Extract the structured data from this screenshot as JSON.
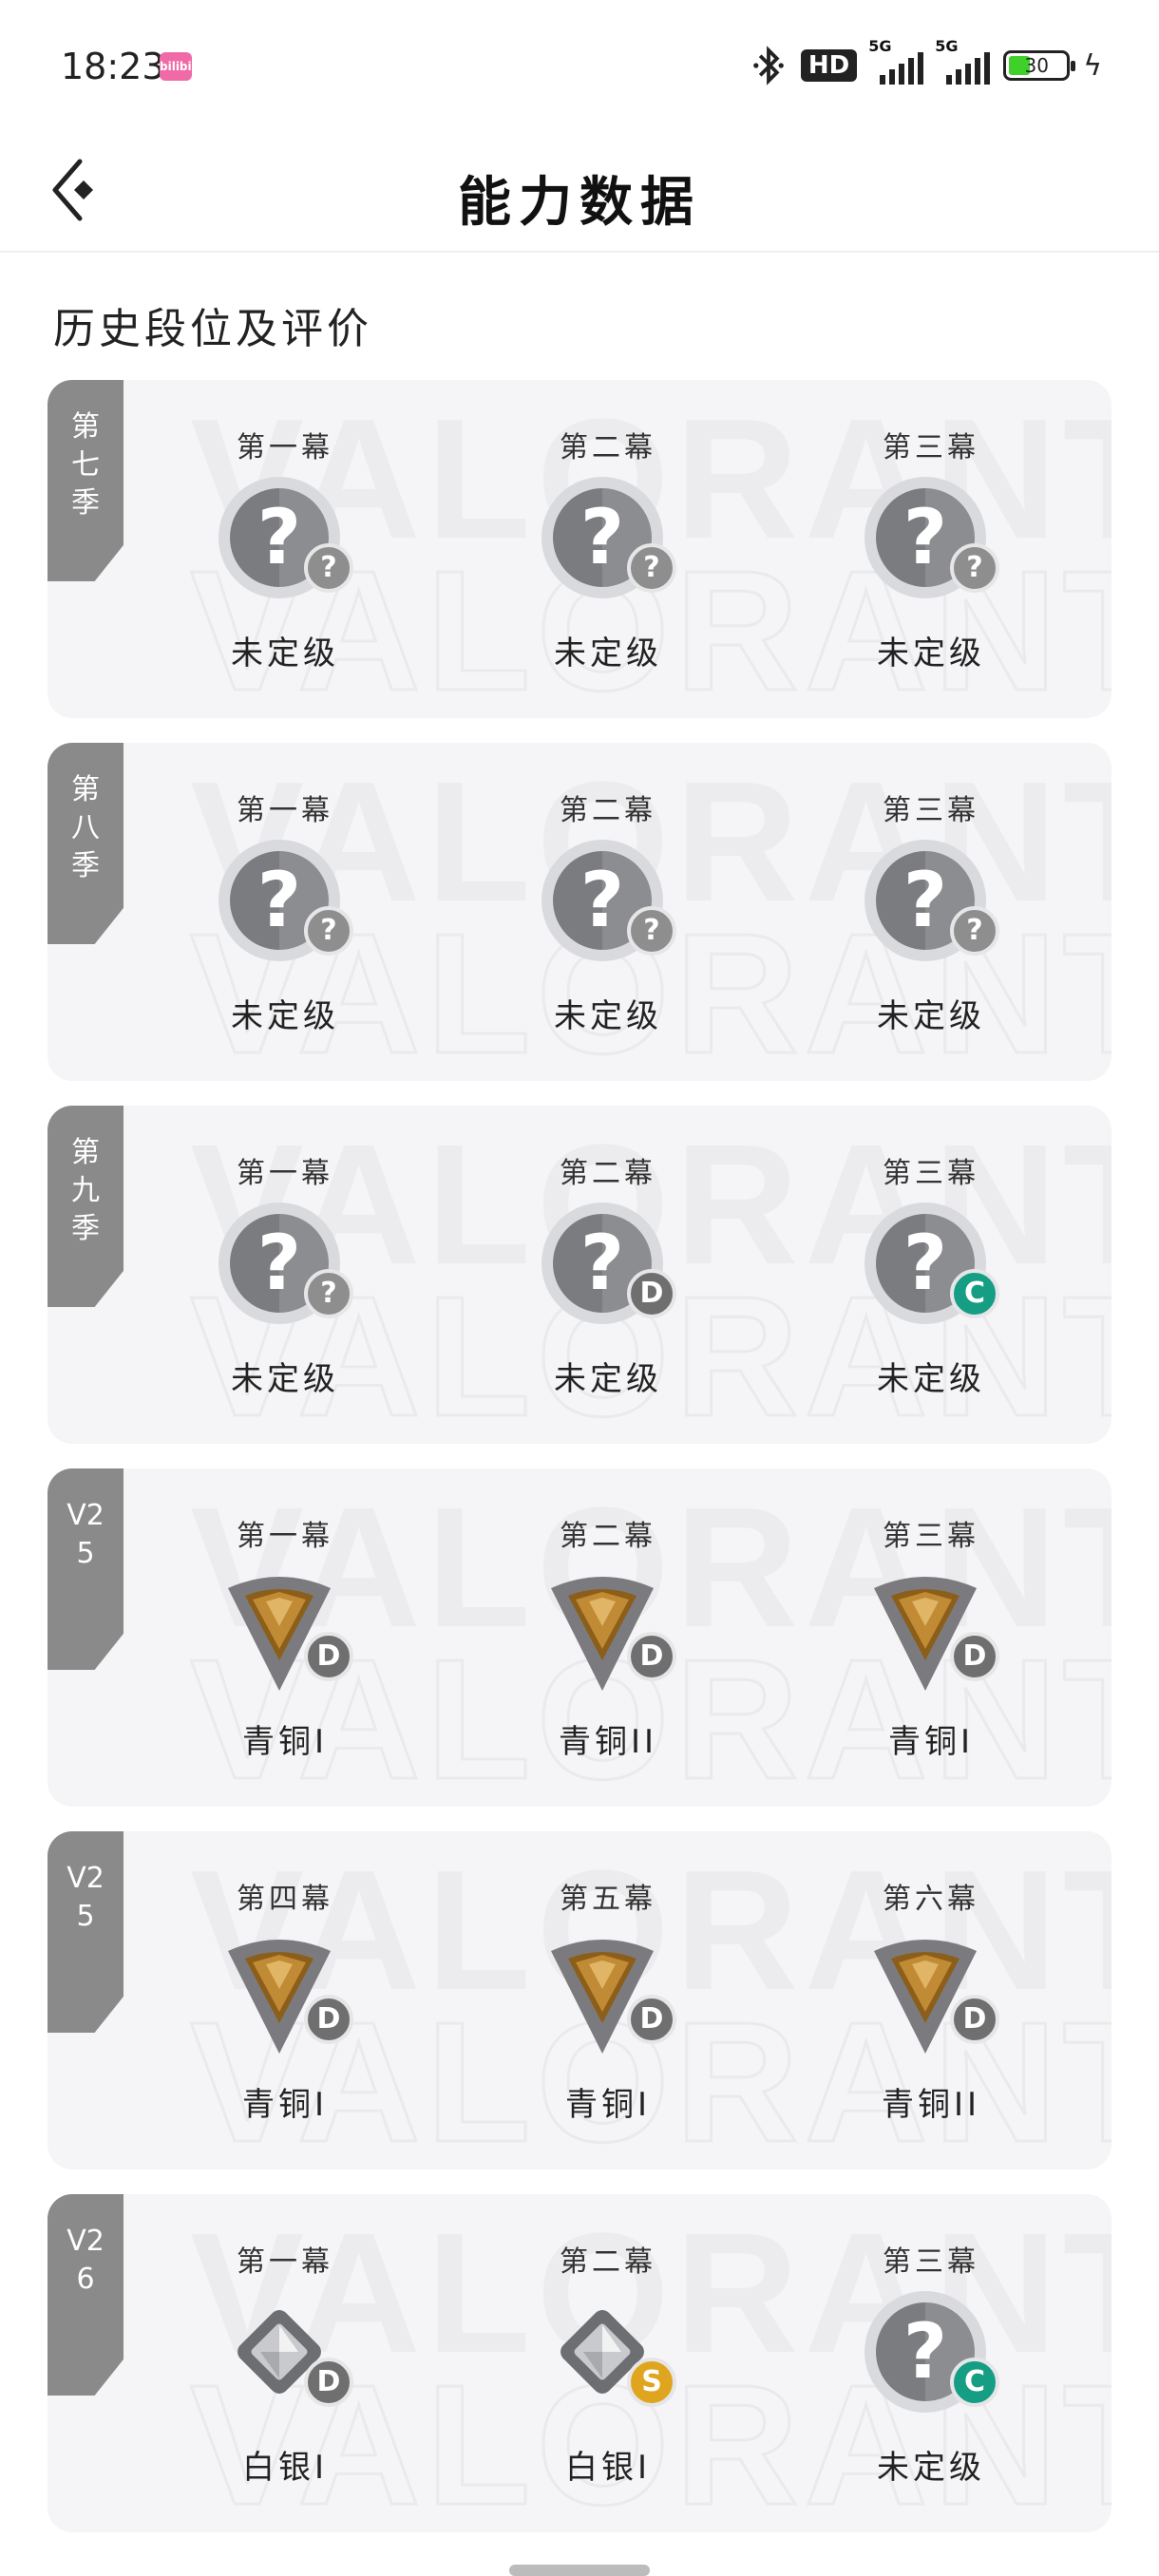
{
  "status_bar": {
    "time": "18:23",
    "app_badge": "bilibili",
    "hd": "HD",
    "net1": "5G",
    "net2": "5G",
    "battery": "30"
  },
  "header": {
    "title": "能力数据"
  },
  "section_title": "历史段位及评价",
  "watermark": "VALORANT",
  "colors": {
    "grade_gray": "#8e8e8e",
    "grade_d": "#6f6f6f",
    "grade_c": "#169e84",
    "grade_s": "#e0a51e",
    "tag_bg": "#8a8a8a",
    "card_bg": "#f5f5f7"
  },
  "seasons": [
    {
      "tag": "第七季",
      "acts": [
        {
          "label": "第一幕",
          "rank": "未定级",
          "icon": "unranked",
          "grade": "?",
          "grade_color": "#8e8e8e"
        },
        {
          "label": "第二幕",
          "rank": "未定级",
          "icon": "unranked",
          "grade": "?",
          "grade_color": "#8e8e8e"
        },
        {
          "label": "第三幕",
          "rank": "未定级",
          "icon": "unranked",
          "grade": "?",
          "grade_color": "#8e8e8e"
        }
      ]
    },
    {
      "tag": "第八季",
      "acts": [
        {
          "label": "第一幕",
          "rank": "未定级",
          "icon": "unranked",
          "grade": "?",
          "grade_color": "#8e8e8e"
        },
        {
          "label": "第二幕",
          "rank": "未定级",
          "icon": "unranked",
          "grade": "?",
          "grade_color": "#8e8e8e"
        },
        {
          "label": "第三幕",
          "rank": "未定级",
          "icon": "unranked",
          "grade": "?",
          "grade_color": "#8e8e8e"
        }
      ]
    },
    {
      "tag": "第九季",
      "acts": [
        {
          "label": "第一幕",
          "rank": "未定级",
          "icon": "unranked",
          "grade": "?",
          "grade_color": "#8e8e8e"
        },
        {
          "label": "第二幕",
          "rank": "未定级",
          "icon": "unranked",
          "grade": "D",
          "grade_color": "#6f6f6f"
        },
        {
          "label": "第三幕",
          "rank": "未定级",
          "icon": "unranked",
          "grade": "C",
          "grade_color": "#169e84"
        }
      ]
    },
    {
      "tag": "V25",
      "acts": [
        {
          "label": "第一幕",
          "rank": "青铜I",
          "icon": "bronze",
          "grade": "D",
          "grade_color": "#6f6f6f"
        },
        {
          "label": "第二幕",
          "rank": "青铜II",
          "icon": "bronze",
          "grade": "D",
          "grade_color": "#6f6f6f"
        },
        {
          "label": "第三幕",
          "rank": "青铜I",
          "icon": "bronze",
          "grade": "D",
          "grade_color": "#6f6f6f"
        }
      ]
    },
    {
      "tag": "V25",
      "acts": [
        {
          "label": "第四幕",
          "rank": "青铜I",
          "icon": "bronze",
          "grade": "D",
          "grade_color": "#6f6f6f"
        },
        {
          "label": "第五幕",
          "rank": "青铜I",
          "icon": "bronze",
          "grade": "D",
          "grade_color": "#6f6f6f"
        },
        {
          "label": "第六幕",
          "rank": "青铜II",
          "icon": "bronze",
          "grade": "D",
          "grade_color": "#6f6f6f"
        }
      ]
    },
    {
      "tag": "V26",
      "acts": [
        {
          "label": "第一幕",
          "rank": "白银I",
          "icon": "silver",
          "grade": "D",
          "grade_color": "#6f6f6f"
        },
        {
          "label": "第二幕",
          "rank": "白银I",
          "icon": "silver",
          "grade": "S",
          "grade_color": "#e0a51e"
        },
        {
          "label": "第三幕",
          "rank": "未定级",
          "icon": "unranked",
          "grade": "C",
          "grade_color": "#169e84"
        }
      ]
    }
  ]
}
